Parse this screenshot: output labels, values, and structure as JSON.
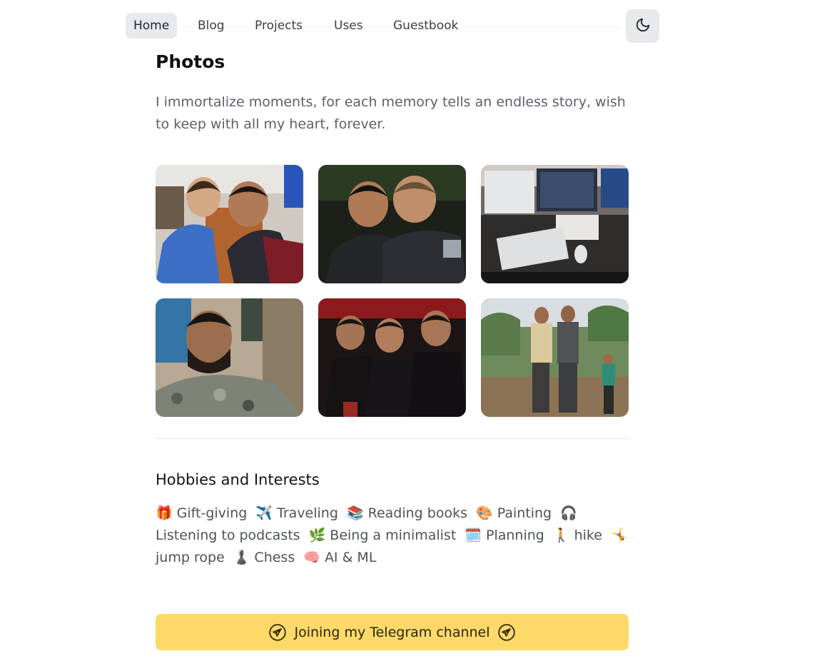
{
  "nav": {
    "items": [
      "Home",
      "Blog",
      "Projects",
      "Uses",
      "Guestbook"
    ],
    "active": "Home"
  },
  "theme_toggle": {
    "icon": "moon-icon"
  },
  "photos": {
    "title": "Photos",
    "intro": "I immortalize moments, for each memory tells an endless story, wish to keep with all my heart, forever."
  },
  "hobbies": {
    "title": "Hobbies and Interests",
    "items": [
      {
        "emoji": "🎁",
        "label": "Gift-giving"
      },
      {
        "emoji": "✈️",
        "label": "Traveling"
      },
      {
        "emoji": "📚",
        "label": "Reading books"
      },
      {
        "emoji": "🎨",
        "label": "Painting"
      },
      {
        "emoji": "🎧",
        "label": "Listening to podcasts"
      },
      {
        "emoji": "🌿",
        "label": "Being a minimalist"
      },
      {
        "emoji": "🗓️",
        "label": "Planning"
      },
      {
        "emoji": "🚶",
        "label": "hike"
      },
      {
        "emoji": "🤸",
        "label": "jump rope"
      },
      {
        "emoji": "♟️",
        "label": "Chess"
      },
      {
        "emoji": "🧠",
        "label": "AI & ML"
      }
    ]
  },
  "telegram": {
    "label": "Joining my Telegram channel",
    "icon": "telegram-icon",
    "color": "#fdd96a"
  }
}
